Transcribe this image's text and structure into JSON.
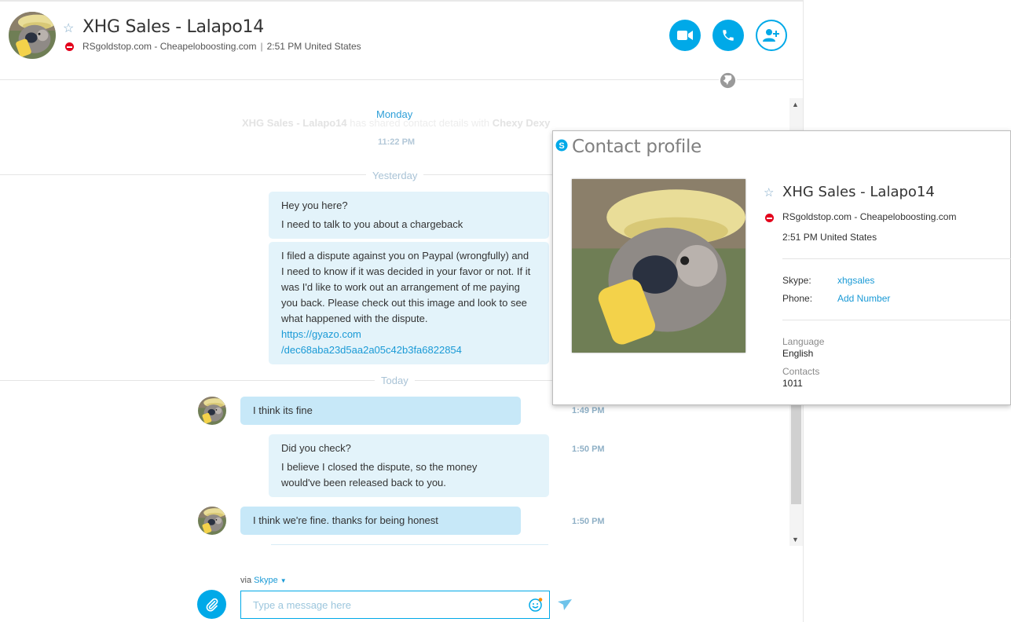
{
  "header": {
    "title": "XHG Sales - Lalapo14",
    "mood": "RSgoldstop.com - Cheapeloboosting.com",
    "separator": "|",
    "local_time": "2:51 PM United States",
    "status_color": "#e3001b"
  },
  "chat": {
    "ghost_day": "Monday",
    "ghost_event": {
      "actor": "XHG Sales - Lalapo14",
      "action": "has shared contact details with",
      "target": "Chexy Dexy",
      "time": "11:22 PM"
    },
    "yesterday_label": "Yesterday",
    "today_label": "Today",
    "messages_yesterday": [
      {
        "lines": [
          "Hey you here?",
          "I need to talk to you about a chargeback"
        ]
      },
      {
        "text": "I filed a dispute against you on Paypal (wrongfully) and I need to know if it was decided in your favor or not. If it was I'd like to work out an arrangement of me paying you back. Please check out this image and look to see what happened with the dispute.",
        "link_line1": "https://gyazo.com",
        "link_line2": "/dec68aba23d5aa2a05c42b3fa6822854"
      }
    ],
    "messages_today": [
      {
        "from": "them",
        "text": "I think its fine",
        "time": "1:49 PM"
      },
      {
        "from": "me",
        "lines": [
          "Did you check?",
          "I believe I closed the dispute, so the money would've been released back to you."
        ],
        "time": "1:50 PM"
      },
      {
        "from": "them",
        "text": "I think we're fine. thanks for being honest",
        "time": "1:50 PM"
      }
    ]
  },
  "composer": {
    "via_prefix": "via",
    "via_service": "Skype",
    "placeholder": "Type a message here"
  },
  "profile": {
    "title": "Contact profile",
    "name": "XHG Sales - Lalapo14",
    "mood": "RSgoldstop.com - Cheapeloboosting.com",
    "local_time": "2:51 PM United States",
    "skype_label": "Skype:",
    "skype_value": "xhgsales",
    "phone_label": "Phone:",
    "phone_value": "Add Number",
    "language_label": "Language",
    "language_value": "English",
    "contacts_label": "Contacts",
    "contacts_value": "1011"
  },
  "colors": {
    "accent": "#00a9e8",
    "bubble_me": "#e3f3fa",
    "bubble_them": "#c7e8f8",
    "status_dnd": "#e3001b"
  }
}
